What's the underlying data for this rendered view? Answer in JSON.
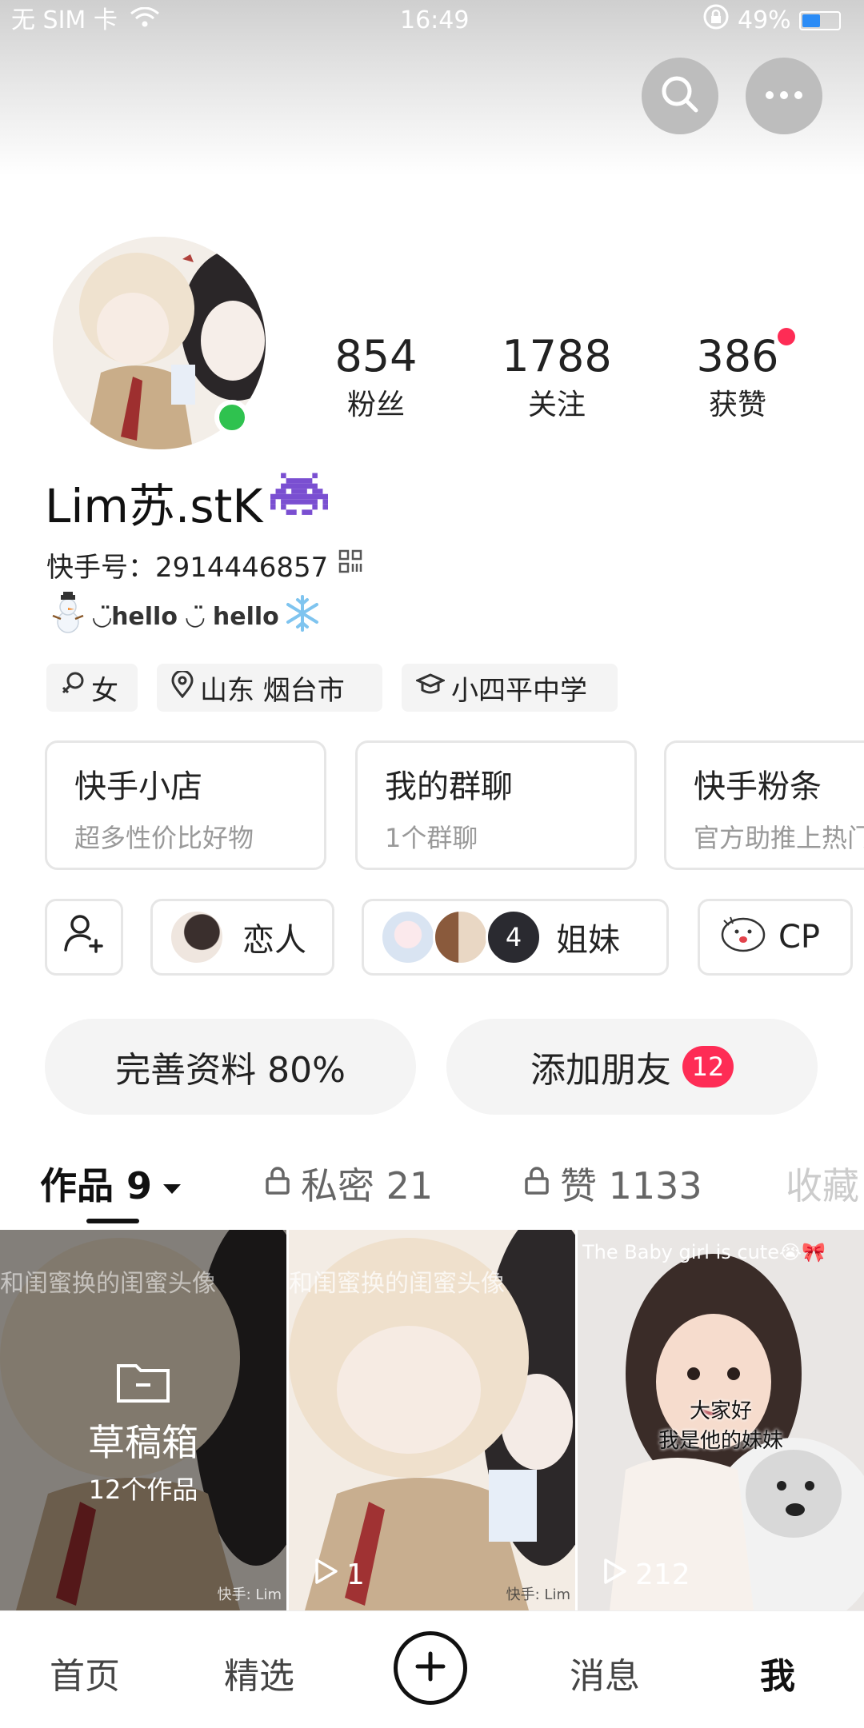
{
  "status_bar": {
    "carrier": "无 SIM 卡",
    "time": "16:49",
    "battery": "49%",
    "battery_level": 0.49
  },
  "profile": {
    "stats": [
      {
        "value": "854",
        "label": "粉丝"
      },
      {
        "value": "1788",
        "label": "关注"
      },
      {
        "value": "386",
        "label": "获赞"
      }
    ],
    "name": "Lim苏.stK",
    "kwai_id_label": "快手号：",
    "kwai_id": "2914446857",
    "bio": "◡̈hello ◡̈ hello",
    "tags": [
      {
        "icon": "female-icon",
        "label": "女"
      },
      {
        "icon": "location-icon",
        "label": "山东 烟台市"
      },
      {
        "icon": "school-icon",
        "label": "小四平中学"
      }
    ]
  },
  "cards": [
    {
      "title": "快手小店",
      "subtitle": "超多性价比好物"
    },
    {
      "title": "我的群聊",
      "subtitle": "1个群聊"
    },
    {
      "title": "快手粉条",
      "subtitle": "官方助推上热门"
    }
  ],
  "relations": [
    {
      "label": "恋人"
    },
    {
      "label": "姐妹",
      "count": "4"
    },
    {
      "label": "CP"
    }
  ],
  "actions": {
    "complete_profile": "完善资料 80%",
    "add_friends": "添加朋友",
    "add_friends_badge": "12"
  },
  "tabs": [
    {
      "label": "作品 9"
    },
    {
      "label": "私密 21"
    },
    {
      "label": "赞 1133"
    },
    {
      "label": "收藏"
    }
  ],
  "grid": [
    {
      "overlay": "和闺蜜换的闺蜜头像",
      "draft_title": "草稿箱",
      "draft_sub": "12个作品",
      "watermark": "快手: Lim"
    },
    {
      "overlay": "和闺蜜换的闺蜜头像",
      "plays": "1",
      "watermark": "快手: Lim"
    },
    {
      "overlay": "The Baby girl is cute😭🎀",
      "caption1": "大家好",
      "caption2": "我是他的妹妹",
      "plays": "212"
    }
  ],
  "bottom_nav": {
    "home": "首页",
    "featured": "精选",
    "messages": "消息",
    "me": "我"
  },
  "colors": {
    "accent": "#fe2c55",
    "online": "#2fc24f"
  }
}
